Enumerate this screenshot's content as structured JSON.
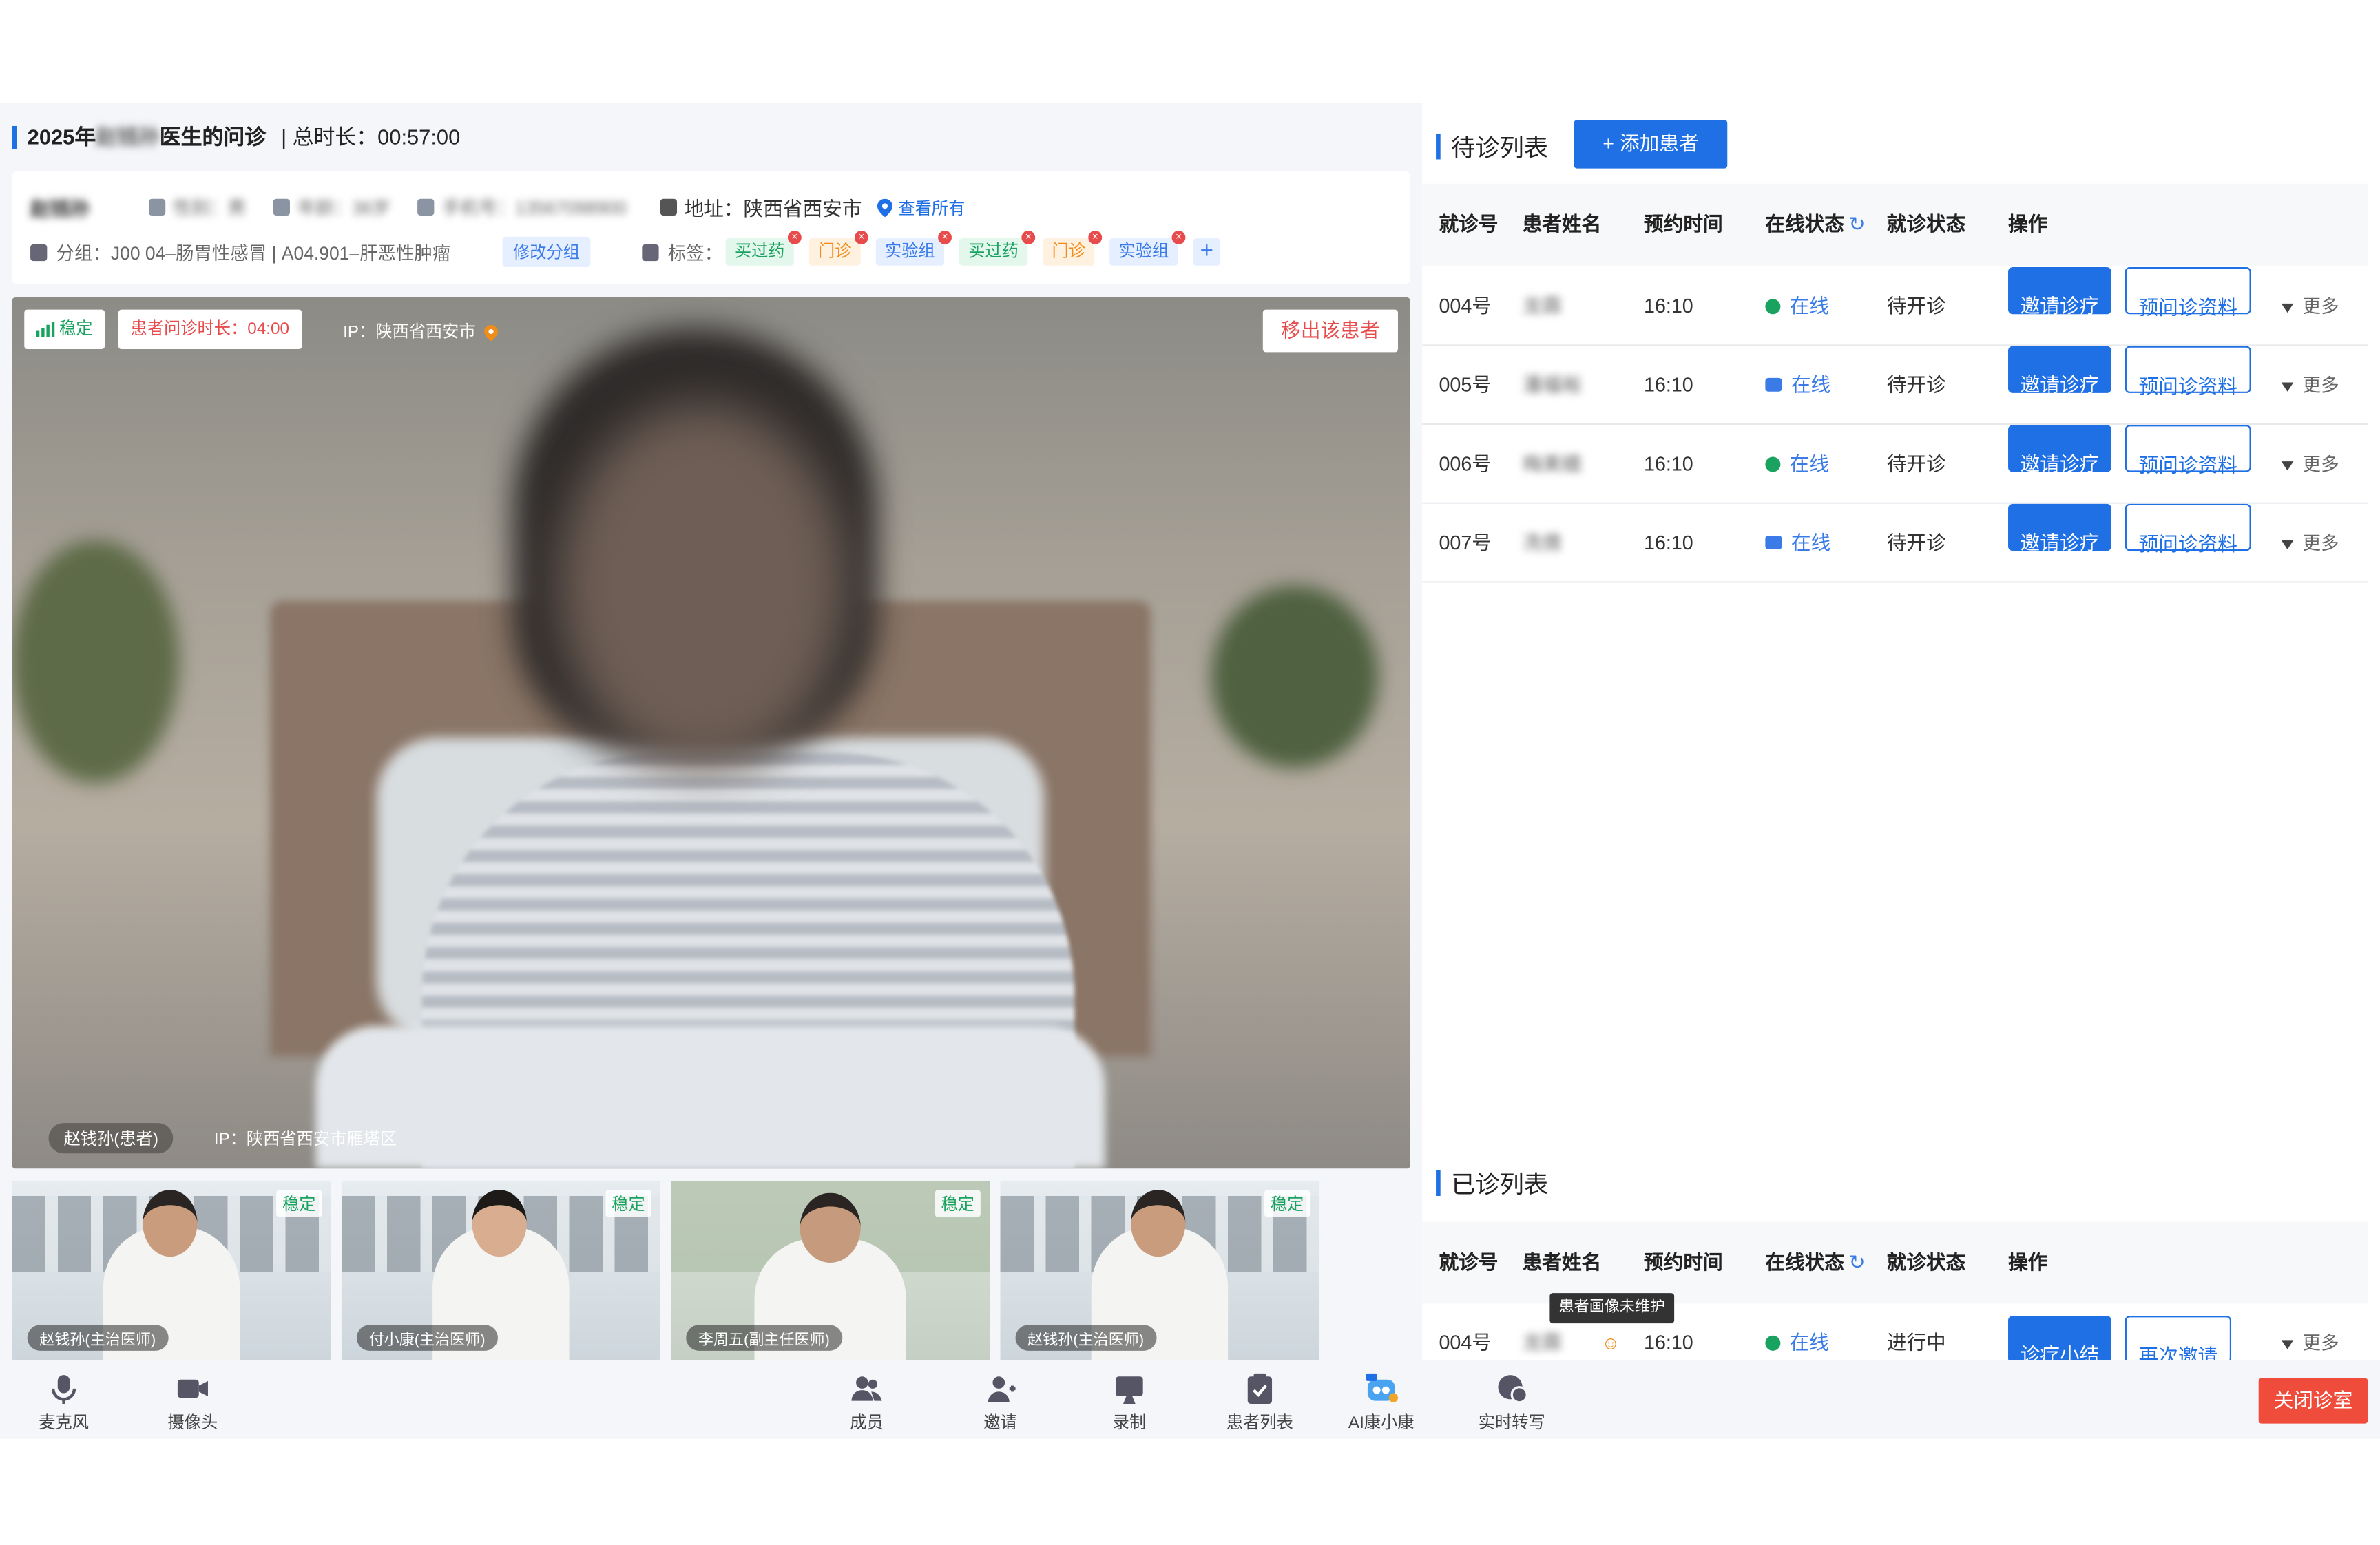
{
  "header": {
    "title_prefix": "2025年",
    "doctor_name": "赵钱孙",
    "title_suffix": "医生的问诊",
    "duration_label": "| 总时长：00:57:00"
  },
  "patient": {
    "name": "赵钱孙",
    "gender": "性别：男",
    "age": "年龄：36岁",
    "phone": "手机号：13567098900",
    "address": "地址：陕西省西安市",
    "view_all": "查看所有",
    "group": "分组：J00 04–肠胃性感冒 | A04.901–肝恶性肿瘤",
    "edit_group": "修改分组",
    "tags_label": "标签：",
    "tags": [
      {
        "text": "买过药",
        "kind": "green"
      },
      {
        "text": "门诊",
        "kind": "orange"
      },
      {
        "text": "实验组",
        "kind": "blue"
      },
      {
        "text": "买过药",
        "kind": "green"
      },
      {
        "text": "门诊",
        "kind": "orange"
      },
      {
        "text": "实验组",
        "kind": "blue"
      }
    ],
    "add_tag": "+"
  },
  "video": {
    "signal": "稳定",
    "consult_time": "患者问诊时长：04:00",
    "ip_top": "IP：陕西省西安市",
    "remove_patient": "移出该患者",
    "caller": "赵钱孙(患者)",
    "ip_bottom": "IP：陕西省西安市雁塔区"
  },
  "thumbnails": [
    {
      "name": "赵钱孙(主治医师)",
      "signal": "稳定"
    },
    {
      "name": "付小康(主治医师)",
      "signal": "稳定"
    },
    {
      "name": "李周五(副主任医师)",
      "signal": "稳定"
    },
    {
      "name": "赵钱孙(主治医师)",
      "signal": "稳定"
    }
  ],
  "toolbar": {
    "mic": "麦克风",
    "camera": "摄像头",
    "members": "成员",
    "invite": "邀请",
    "record": "录制",
    "patient_list": "患者列表",
    "ai": "AI康小康",
    "transcribe": "实时转写",
    "close_room": "关闭诊室"
  },
  "waiting": {
    "title": "待诊列表",
    "add_btn": "+ 添加患者",
    "columns": [
      "就诊号",
      "患者姓名",
      "预约时间",
      "在线状态",
      "就诊状态",
      "操作"
    ],
    "rows": [
      {
        "no": "004号",
        "name": "龙霖",
        "time": "16:10",
        "online": "在线",
        "status": "待开诊",
        "device": "wechat",
        "btn1": "邀请诊疗",
        "btn2": "预问诊资料",
        "more": "更多"
      },
      {
        "no": "005号",
        "name": "潘福裕",
        "time": "16:10",
        "online": "在线",
        "status": "待开诊",
        "device": "app",
        "btn1": "邀请诊疗",
        "btn2": "预问诊资料",
        "more": "更多"
      },
      {
        "no": "006号",
        "name": "梅美娥",
        "time": "16:10",
        "online": "在线",
        "status": "待开诊",
        "device": "wechat",
        "btn1": "邀请诊疗",
        "btn2": "预问诊资料",
        "more": "更多"
      },
      {
        "no": "007号",
        "name": "冼倩",
        "time": "16:10",
        "online": "在线",
        "status": "待开诊",
        "device": "app",
        "btn1": "邀请诊疗",
        "btn2": "预问诊资料",
        "more": "更多"
      }
    ]
  },
  "done": {
    "title": "已诊列表",
    "columns": [
      "就诊号",
      "患者姓名",
      "预约时间",
      "在线状态",
      "就诊状态",
      "操作"
    ],
    "tooltip": "患者画像未维护",
    "rows": [
      {
        "no": "004号",
        "name": "龙霖",
        "time": "16:10",
        "online": "在线",
        "status": "进行中",
        "btn1": "诊疗小结",
        "btn2": "再次邀请",
        "more": "更多"
      }
    ]
  },
  "colors": {
    "accent": "#1f6fe5",
    "online": "#1aa260",
    "danger": "#e84b4b",
    "close": "#f04c3b"
  }
}
